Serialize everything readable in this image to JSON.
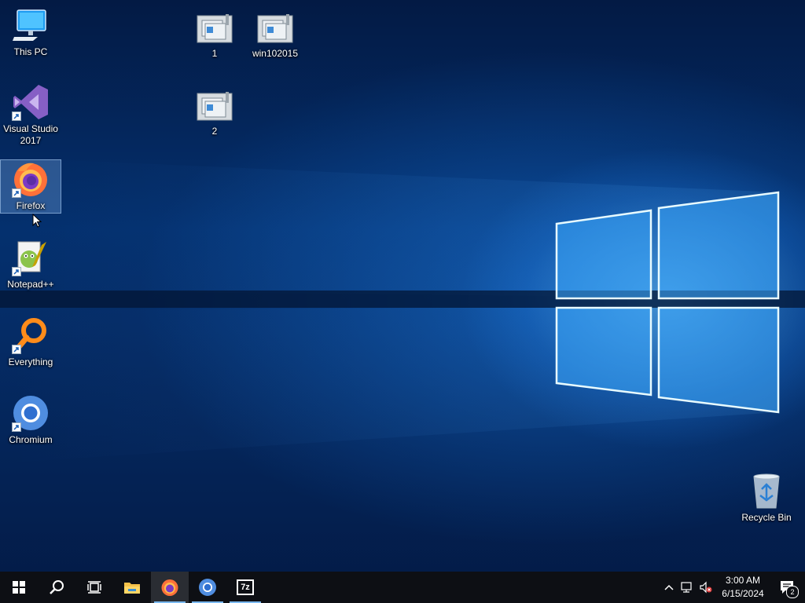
{
  "desktop": {
    "icons": {
      "this_pc": {
        "label": "This PC"
      },
      "visual_studio": {
        "label": "Visual Studio 2017"
      },
      "firefox": {
        "label": "Firefox"
      },
      "notepadpp": {
        "label": "Notepad++"
      },
      "everything": {
        "label": "Everything"
      },
      "chromium": {
        "label": "Chromium"
      },
      "vm1": {
        "label": "1"
      },
      "vm_win": {
        "label": "win102015"
      },
      "vm2": {
        "label": "2"
      },
      "recycle_bin": {
        "label": "Recycle Bin"
      }
    }
  },
  "taskbar": {
    "clock": {
      "time": "3:00 AM",
      "date": "6/15/2024"
    },
    "notification_count": "2",
    "sevenzip_label": "7z",
    "accent": "#7ab8f0"
  }
}
